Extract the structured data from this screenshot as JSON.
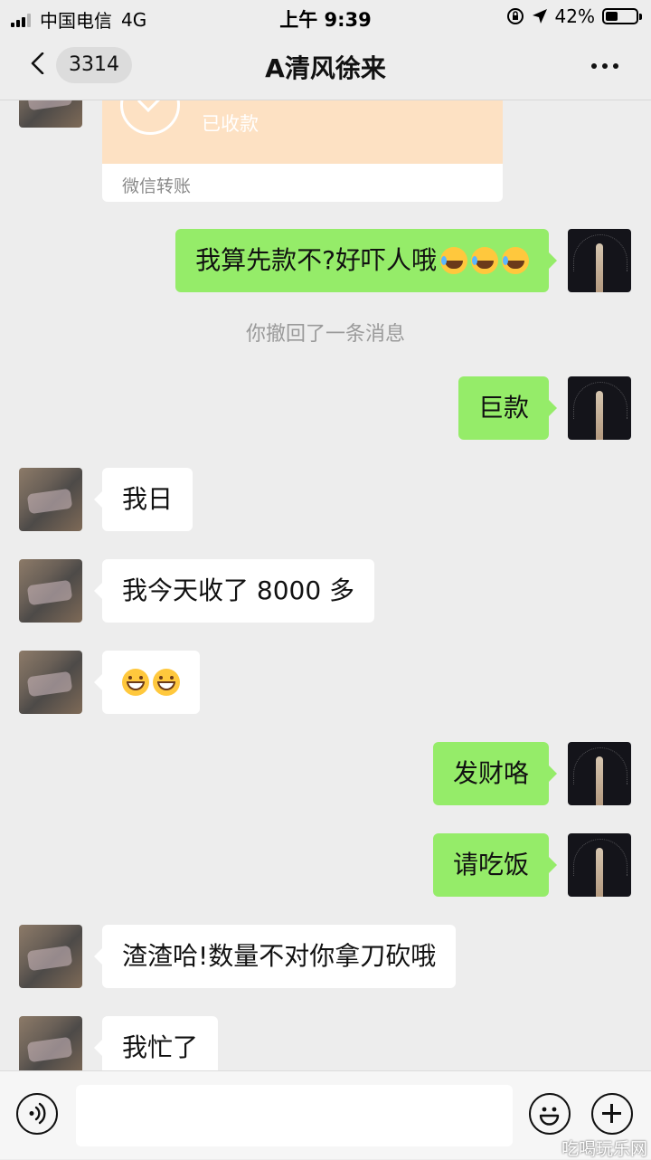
{
  "status_bar": {
    "carrier": "中国电信",
    "network": "4G",
    "time": "上午 9:39",
    "battery": "42%",
    "battery_level": 0.42
  },
  "nav": {
    "unread_count": "3314",
    "title": "A清风徐来"
  },
  "transfer": {
    "status": "已收款",
    "label": "微信转账"
  },
  "messages": [
    {
      "sender": "self",
      "text": "我算先款不?好吓人哦",
      "emoji": [
        "laugh-cry",
        "laugh-cry",
        "laugh-cry"
      ]
    },
    {
      "sender": "system",
      "text": "你撤回了一条消息"
    },
    {
      "sender": "self",
      "text": "巨款"
    },
    {
      "sender": "peer",
      "text": "我日"
    },
    {
      "sender": "peer",
      "text": "我今天收了 8000 多"
    },
    {
      "sender": "peer",
      "text": "",
      "emoji": [
        "grin",
        "grin"
      ]
    },
    {
      "sender": "self",
      "text": "发财咯"
    },
    {
      "sender": "self",
      "text": "请吃饭"
    },
    {
      "sender": "peer",
      "text": "渣渣哈!数量不对你拿刀砍哦"
    },
    {
      "sender": "peer",
      "text": "我忙了"
    }
  ],
  "watermark": "吃喝玩乐网"
}
